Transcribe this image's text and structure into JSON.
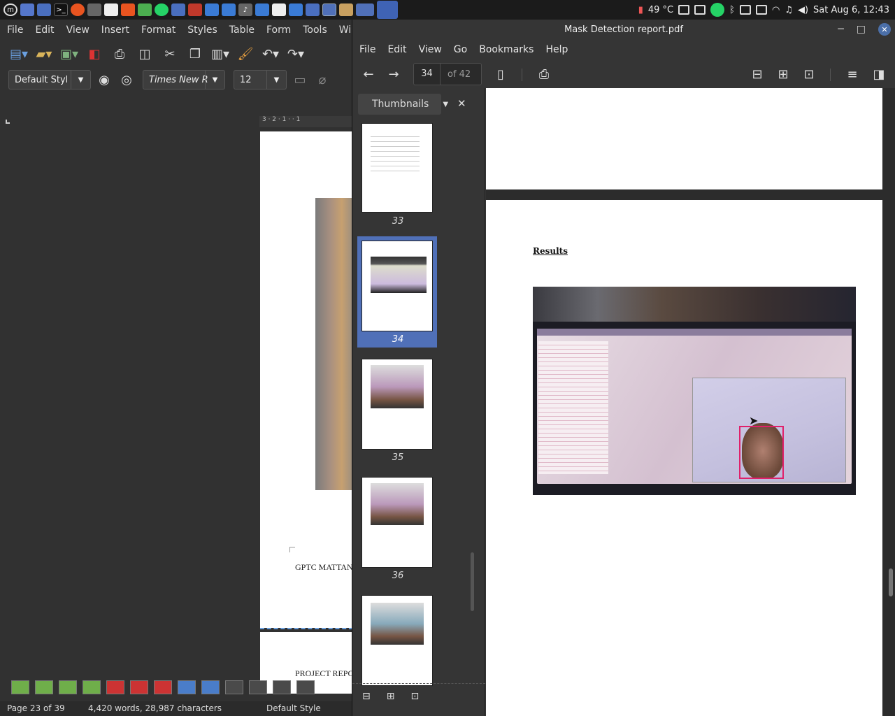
{
  "panel": {
    "temp": "49 °C",
    "clock": "Sat Aug  6, 12:43"
  },
  "writer": {
    "menu": [
      "File",
      "Edit",
      "View",
      "Insert",
      "Format",
      "Styles",
      "Table",
      "Form",
      "Tools",
      "Window"
    ],
    "para_style": "Default Styl",
    "font_name": "Times New R",
    "font_size": "12",
    "ruler": "3 · 2 · 1 ·   · 1",
    "page_text_1": "GPTC MATTANN",
    "page_text_2": "PROJECT REPOE",
    "status_page": "Page 23 of 39",
    "status_words": "4,420 words, 28,987 characters",
    "status_style": "Default Style"
  },
  "pdf": {
    "title": "Mask Detection report.pdf",
    "menu": [
      "File",
      "Edit",
      "View",
      "Go",
      "Bookmarks",
      "Help"
    ],
    "page_current": "34",
    "page_total": "of 42",
    "sidebar_mode": "Thumbnails",
    "thumbs": [
      "33",
      "34",
      "35",
      "36"
    ],
    "selected_thumb": "34",
    "heading": "Results"
  }
}
